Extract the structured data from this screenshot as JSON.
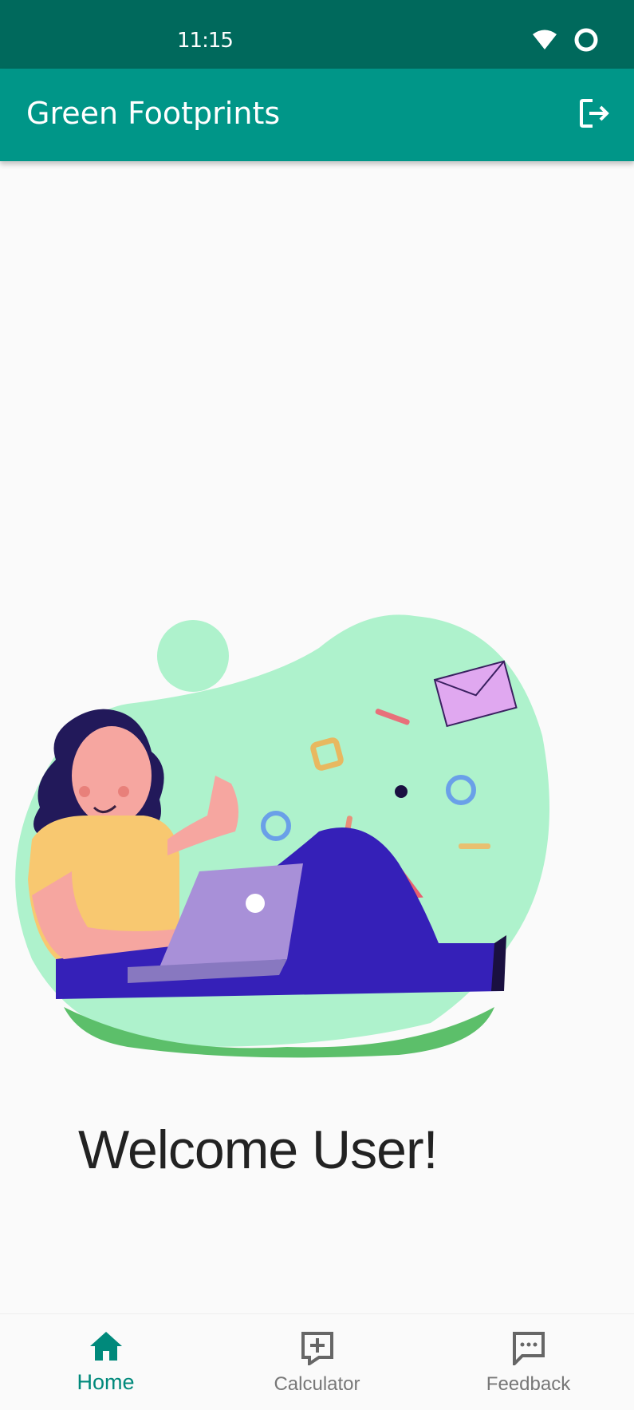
{
  "status_bar": {
    "time": "11:15",
    "icons": [
      "wifi-icon",
      "battery-ring-icon"
    ]
  },
  "app_bar": {
    "title": "Green Footprints",
    "action_icon": "logout-icon"
  },
  "main": {
    "illustration": "woman-with-laptop-illustration",
    "welcome_text": "Welcome User!"
  },
  "bottom_nav": {
    "items": [
      {
        "label": "Home",
        "icon": "home-icon",
        "active": true
      },
      {
        "label": "Calculator",
        "icon": "calculator-add-icon",
        "active": false
      },
      {
        "label": "Feedback",
        "icon": "feedback-icon",
        "active": false
      }
    ]
  },
  "colors": {
    "status_bar": "#00695c",
    "app_bar": "#009688",
    "accent": "#00897b",
    "blob": "#aef2cc"
  }
}
